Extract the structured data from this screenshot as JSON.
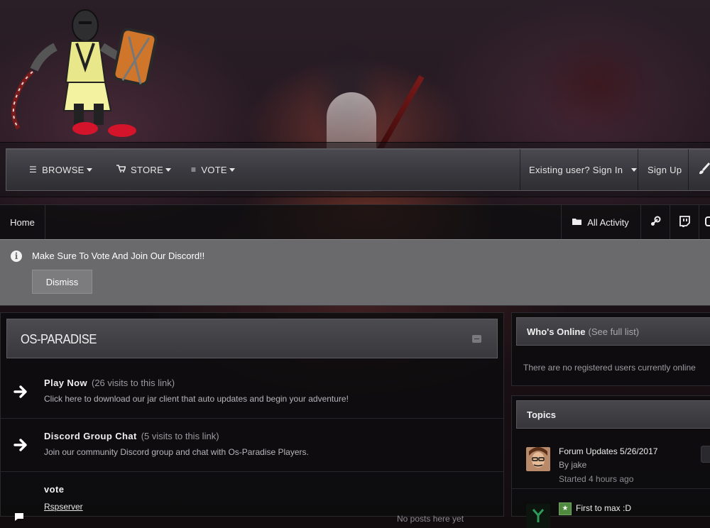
{
  "nav": {
    "items": [
      {
        "label": "BROWSE",
        "icon": "list-icon"
      },
      {
        "label": "STORE",
        "icon": "cart-icon"
      },
      {
        "label": "VOTE",
        "icon": "menu-icon"
      }
    ],
    "sign_in": "Existing user? Sign In",
    "sign_up": "Sign Up",
    "extra_icon": "brush-icon"
  },
  "breadcrumb": {
    "home": "Home",
    "all_activity": "All Activity",
    "icons": [
      "steam-icon",
      "twitch-icon"
    ]
  },
  "announcement": {
    "text": "Make Sure To Vote And Join Our Discord!!",
    "dismiss": "Dismiss",
    "icon": "info-icon"
  },
  "forum": {
    "title": "OS-PARADISE",
    "rows": [
      {
        "title": "Play Now",
        "visits": "(26 visits to this link)",
        "desc": "Click here to download our jar client that auto updates and begin your adventure!"
      },
      {
        "title": "Discord Group Chat",
        "visits": "(5 visits to this link)",
        "desc": "Join our community Discord group and chat with Os-Paradise Players."
      },
      {
        "title": "vote",
        "subforum": "Rspserver",
        "no_posts": "No posts here yet"
      }
    ]
  },
  "sidebar": {
    "online": {
      "title": "Who's Online",
      "see_all": "(See full list)",
      "empty_text": "There are no registered users currently online"
    },
    "topics": {
      "title": "Topics",
      "items": [
        {
          "title": "Forum Updates 5/26/2017",
          "by": "By jake",
          "time": "Started 4 hours ago"
        },
        {
          "title": "First to max :D",
          "pinned": true
        }
      ]
    }
  },
  "colors": {
    "announcement_bg": "#6a6a6c",
    "pin_badge": "#4f8a3e"
  }
}
